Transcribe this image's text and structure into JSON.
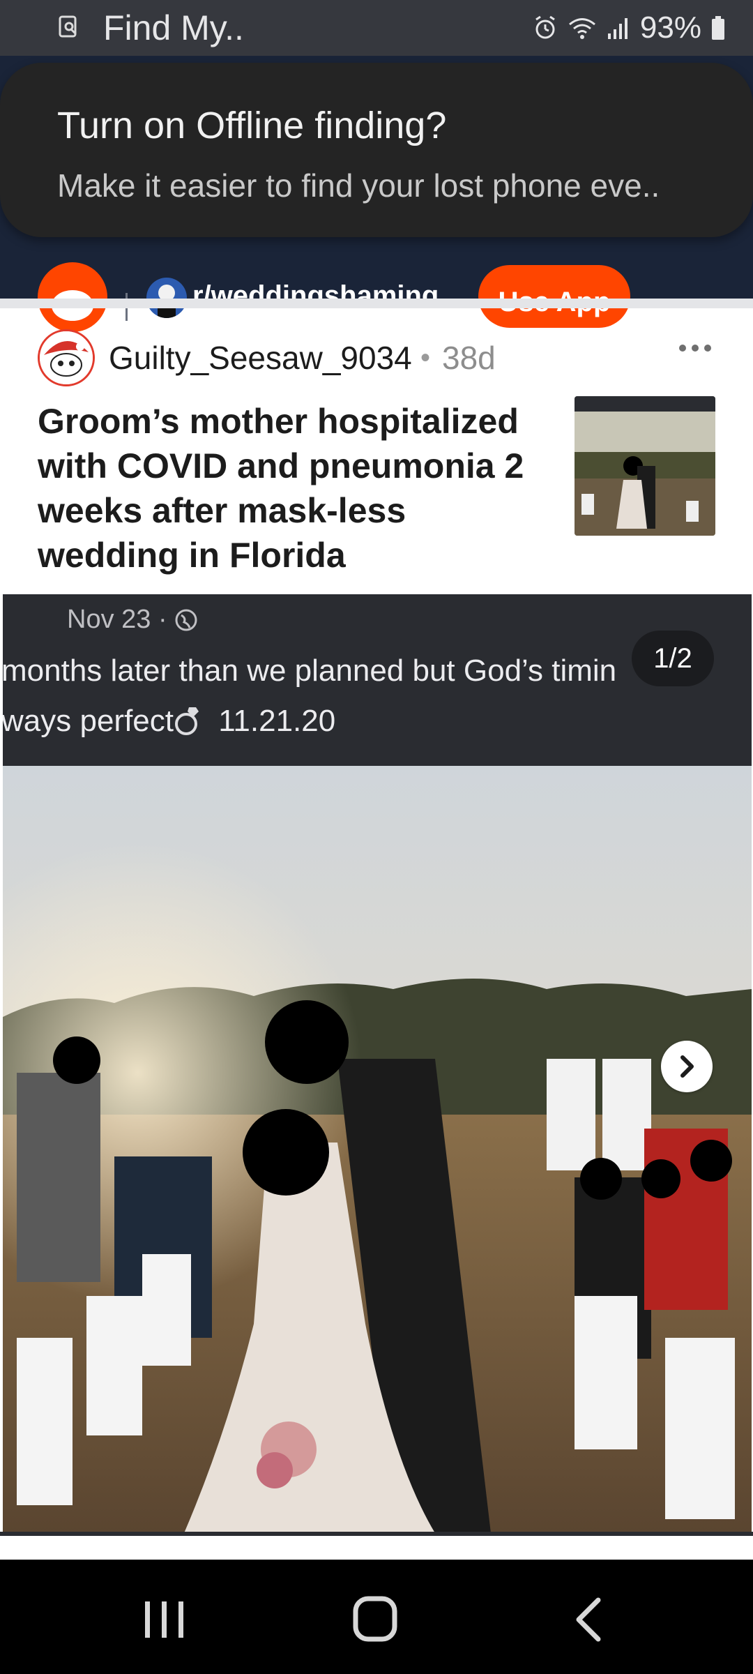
{
  "status_bar": {
    "app_title": "Find My..",
    "battery_percent": "93%",
    "icons": [
      "find-my-app-icon",
      "alarm-icon",
      "wifi-icon",
      "signal-icon",
      "battery-icon"
    ]
  },
  "notification": {
    "title": "Turn on Offline finding?",
    "body": "Make it easier to find your lost phone eve.."
  },
  "reddit_header": {
    "subreddit": "r/weddingshaming",
    "use_app_label": "Use App",
    "accent_color": "#ff4500",
    "header_bg": "#1a2438"
  },
  "post": {
    "author": "Guilty_Seesaw_9034",
    "separator": "•",
    "age": "38d",
    "title": "Groom’s mother hospitalized with COVID and pneumonia 2 weeks after mask-less wedding in Florida"
  },
  "gallery": {
    "date_line": "Nov 23 · ",
    "caption_line_1": "months later than we planned but God’s timin",
    "caption_line_2": "ways perfect",
    "caption_date": "11.21.20",
    "counter": "1/2",
    "icons": [
      "globe-icon",
      "ring-icon",
      "chevron-right-icon"
    ]
  },
  "nav_bar": {
    "icons": [
      "recent-apps-icon",
      "home-icon",
      "back-icon"
    ]
  }
}
